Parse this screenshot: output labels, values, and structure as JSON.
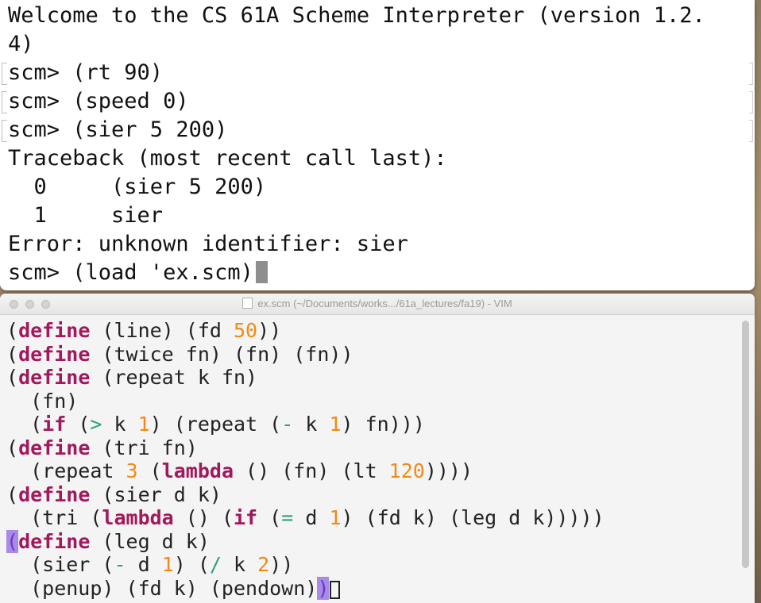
{
  "terminal": {
    "lines": [
      "Welcome to the CS 61A Scheme Interpreter (version 1.2.",
      "4)",
      "scm> (rt 90)",
      "scm> (speed 0)",
      "scm> (sier 5 200)",
      "Traceback (most recent call last):",
      "  0     (sier 5 200)",
      "  1     sier",
      "Error: unknown identifier: sier",
      "scm> (load 'ex.scm)"
    ]
  },
  "vim": {
    "title": "ex.scm (~/Documents/works.../61a_lectures/fa19) - VIM",
    "file_icon": "scheme-file-icon",
    "code_lines": [
      "(define (line) (fd 50))",
      "(define (twice fn) (fn) (fn))",
      "(define (repeat k fn)",
      "  (fn)",
      "  (if (> k 1) (repeat (- k 1) fn)))",
      "(define (tri fn)",
      "  (repeat 3 (lambda () (fn) (lt 120))))",
      "(define (sier d k)",
      "  (tri (lambda () (if (= d 1) (fd k) (leg d k)))))",
      "(define (leg d k)",
      "  (sier (- d 1) (/ k 2))",
      "  (penup) (fd k) (pendown))"
    ]
  },
  "colors": {
    "keyword": "#a1185c",
    "number": "#f08a16",
    "operator": "#2aa181",
    "paren_match": "#a98ae6",
    "terminal_bg": "#ffffff",
    "vim_bg": "#f4f4f4"
  }
}
